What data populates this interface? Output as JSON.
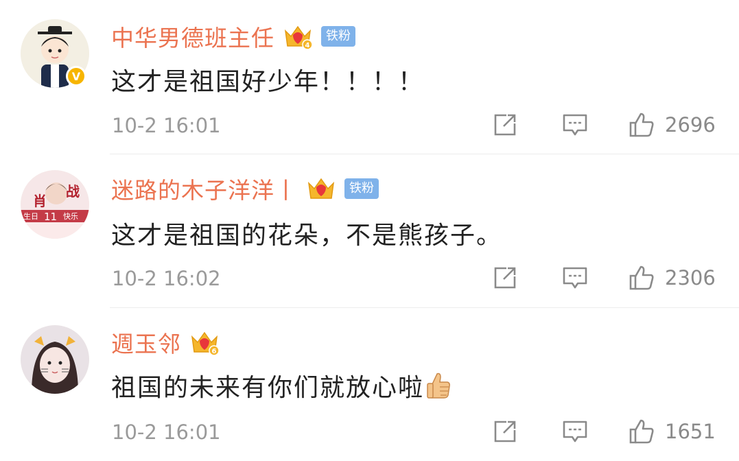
{
  "comments": [
    {
      "username": "中华男德班主任",
      "crown_level": "4",
      "fan_badge": "铁粉",
      "verified": true,
      "text": "这才是祖国好少年！！！！",
      "time": "10-2 16:01",
      "likes": "2696",
      "avatar_icon": "cartoon-scholar-avatar"
    },
    {
      "username": "迷路的木子洋洋丨",
      "crown_level": "",
      "fan_badge": "铁粉",
      "verified": false,
      "text": "这才是祖国的花朵，不是熊孩子。",
      "time": "10-2 16:02",
      "likes": "2306",
      "avatar_icon": "idol-photo-avatar",
      "avatar_text": [
        "肖",
        "战",
        "生日",
        "11",
        "快乐"
      ]
    },
    {
      "username": "週玉邻",
      "crown_level": "6",
      "fan_badge": "",
      "verified": false,
      "text": "祖国的未来有你们就放心啦",
      "text_emoji": "thumbs-up-emoji",
      "time": "10-2 16:01",
      "likes": "1651",
      "avatar_icon": "girl-photo-avatar"
    }
  ],
  "colors": {
    "username": "#eb7350",
    "badge": "#7fb2ea",
    "crown": "#f5b62c",
    "meta": "#9a9a9a",
    "text": "#222222"
  }
}
